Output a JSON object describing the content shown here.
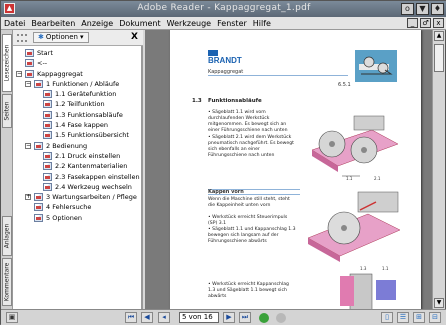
{
  "window": {
    "title": "Adobe Reader - Kappaggregat_1.pdf",
    "app_icon": "pdf-icon",
    "buttons": [
      "o",
      "▼",
      "♦"
    ]
  },
  "menu": {
    "items": [
      "Datei",
      "Bearbeiten",
      "Anzeige",
      "Dokument",
      "Werkzeuge",
      "Fenster",
      "Hilfe"
    ],
    "doc_buttons": [
      "_",
      "♂",
      "x"
    ]
  },
  "side_tabs": [
    "Lesezeichen",
    "Seiten",
    "Anlagen",
    "Kommentare"
  ],
  "nav_panel": {
    "options_label": "Optionen",
    "close": "X",
    "tree": [
      {
        "label": "Start",
        "level": 0,
        "exp": ""
      },
      {
        "label": "<--",
        "level": 0,
        "exp": ""
      },
      {
        "label": "Kappaggregat",
        "level": 0,
        "exp": "−"
      },
      {
        "label": "1 Funktionen / Abläufe",
        "level": 1,
        "exp": "−"
      },
      {
        "label": "1.1 Gerätefunktion",
        "level": 2,
        "exp": ""
      },
      {
        "label": "1.2 Teilfunktion",
        "level": 2,
        "exp": ""
      },
      {
        "label": "1.3 Funktionsabläufe",
        "level": 2,
        "exp": ""
      },
      {
        "label": "1.4 Fase kappen",
        "level": 2,
        "exp": ""
      },
      {
        "label": "1.5 Funktionsübersicht",
        "level": 2,
        "exp": ""
      },
      {
        "label": "2 Bedienung",
        "level": 1,
        "exp": "−"
      },
      {
        "label": "2.1 Druck einstellen",
        "level": 2,
        "exp": ""
      },
      {
        "label": "2.2 Kantenmaterialien",
        "level": 2,
        "exp": ""
      },
      {
        "label": "2.3 Fasekappen einstellen",
        "level": 2,
        "exp": ""
      },
      {
        "label": "2.4 Werkzeug wechseln",
        "level": 2,
        "exp": ""
      },
      {
        "label": "3 Wartungsarbeiten / Pflege",
        "level": 1,
        "exp": "+"
      },
      {
        "label": "4 Fehlersuche",
        "level": 1,
        "exp": ""
      },
      {
        "label": "5 Optionen",
        "level": 1,
        "exp": ""
      }
    ]
  },
  "page": {
    "logo": "BRANDT",
    "subtitle": "Kappaggregat",
    "page_number": "6.5.1",
    "section_number": "1.3",
    "section_title": "Funktionsabläufe",
    "para1": "• Sägeblatt 1.1 wird vom durchlaufenden Werkstück mitgenommen. Es bewegt sich an einer Führungsschiene nach unten",
    "para2": "• Sägeblatt 2.1 wird dem Werkstück pneumatisch nachgeführt. Es bewegt sich ebenfalls an einer Führungsschiene nach unten",
    "bar_title": "Kappen vorn",
    "para3": "Wenn die Maschine still steht, steht die Kappeinheit unten vorn",
    "para4": "• Werkstück erreicht Steuerimpuls (SP) 3.1",
    "para5": "• Sägeblatt 1.1 und Kappanschlag 1.3 bewegen sich langsam auf der Führungsschiene abwärts",
    "para6": "• Werkstück erreicht Kappanschlag 1.3 und Sägeblatt 1.1 bewegt sich abwärts",
    "fig1_labels": [
      "1.1",
      "2.1"
    ],
    "fig2_labels": [
      "1.3",
      "1.1"
    ]
  },
  "status": {
    "page_field": "5 von 16"
  },
  "colors": {
    "title_bar": "#5c6876",
    "brand": "#1b62b1",
    "pink": "#e07bb0"
  }
}
